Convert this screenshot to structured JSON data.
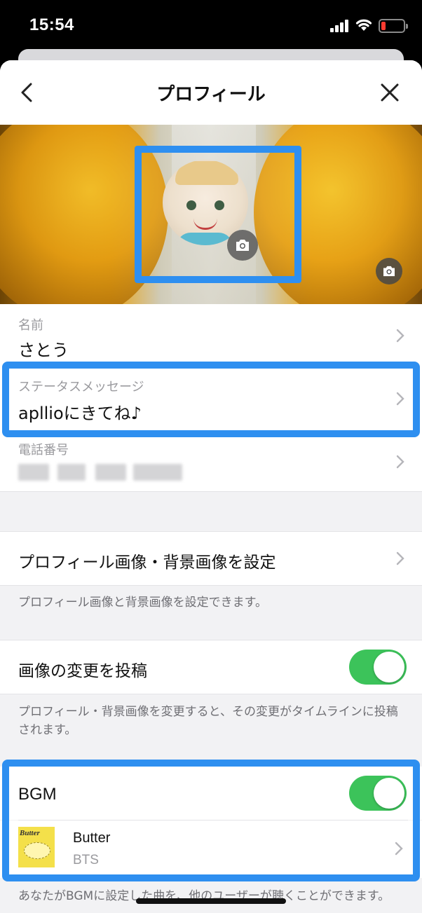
{
  "status_bar": {
    "time": "15:54",
    "battery_color": "#ff3b30",
    "icons": [
      "signal-icon",
      "wifi-icon",
      "battery-icon"
    ]
  },
  "nav": {
    "title": "プロフィール",
    "back_icon": "chevron-left-icon",
    "close_icon": "close-icon"
  },
  "cover": {
    "avatar_camera_icon": "camera-icon",
    "cover_camera_icon": "camera-icon"
  },
  "profile": {
    "name_label": "名前",
    "name_value": "さとう",
    "status_label": "ステータスメッセージ",
    "status_value": "apllioにきてね♪",
    "phone_label": "電話番号"
  },
  "settings": {
    "set_images_label": "プロフィール画像・背景画像を設定",
    "set_images_desc": "プロフィール画像と背景画像を設定できます。",
    "post_change_label": "画像の変更を投稿",
    "post_change_on": true,
    "post_change_desc": "プロフィール・背景画像を変更すると、その変更がタイムラインに投稿されます。",
    "bgm_label": "BGM",
    "bgm_on": true,
    "bgm_desc": "あなたがBGMに設定した曲を、他のユーザーが聴くことができます。"
  },
  "bgm_song": {
    "title": "Butter",
    "artist": "BTS",
    "album_text": "Butter"
  },
  "colors": {
    "accent_toggle": "#3cc35a",
    "highlight_frame": "#2e8ff0",
    "background": "#f2f2f4"
  }
}
